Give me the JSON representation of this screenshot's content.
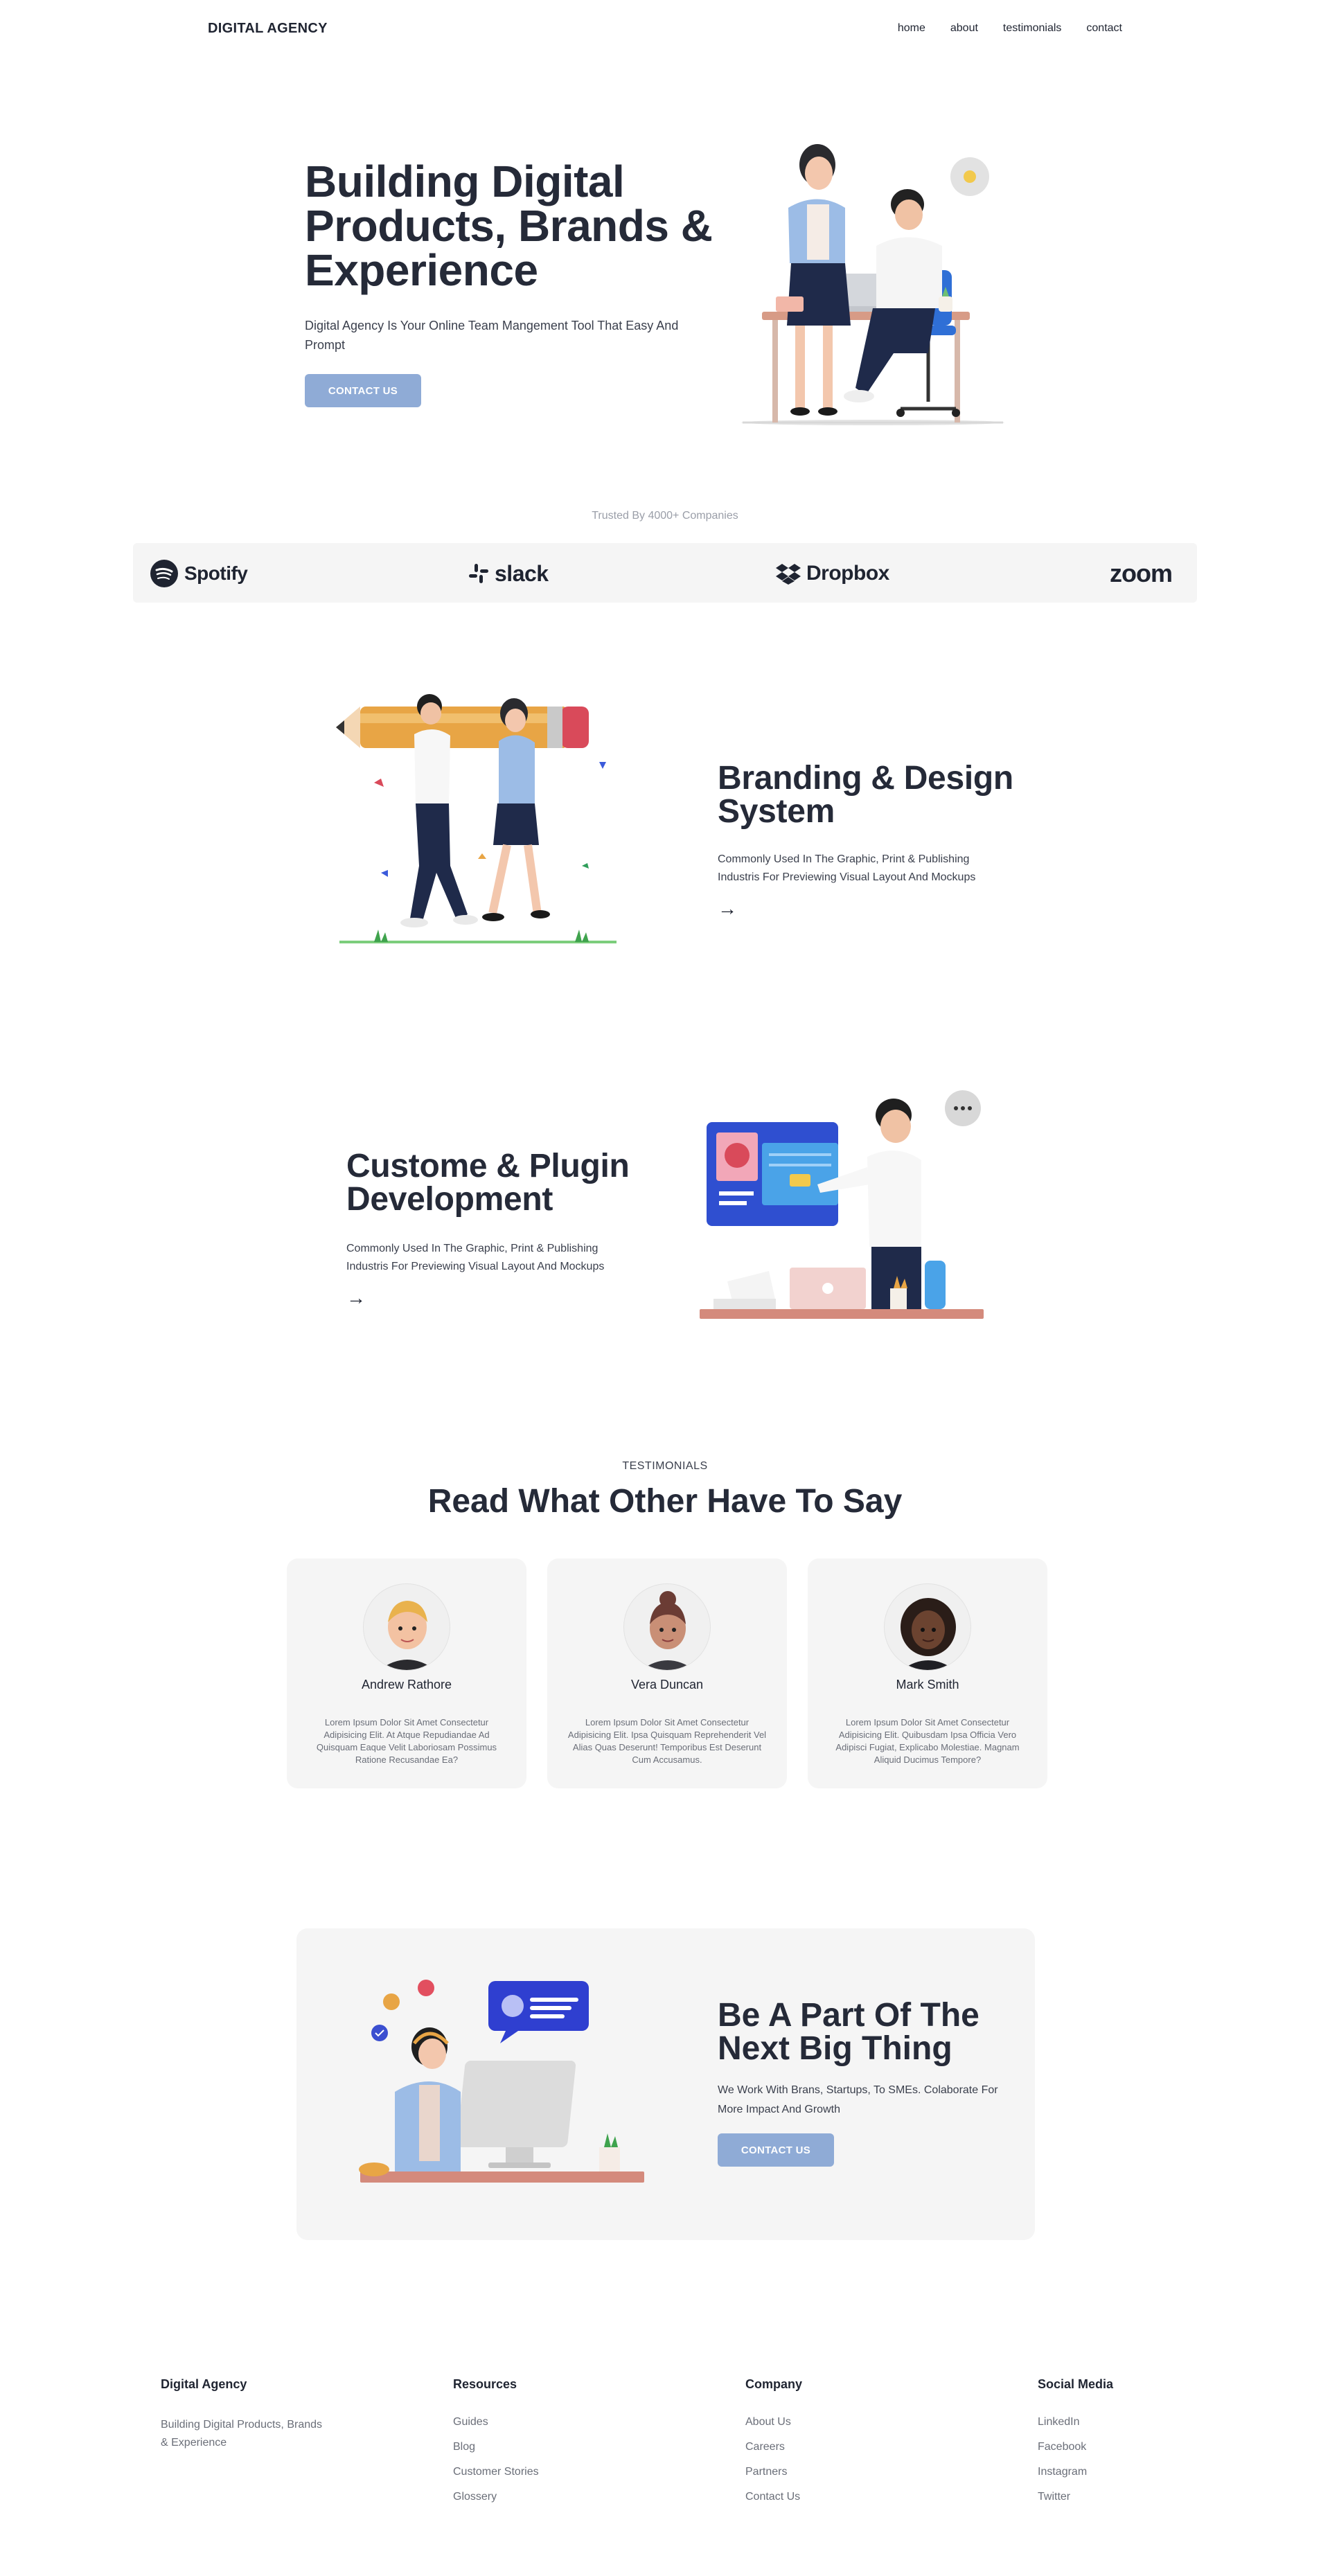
{
  "nav": {
    "brand": "DIGITAL AGENCY",
    "links": [
      "home",
      "about",
      "testimonials",
      "contact"
    ]
  },
  "hero": {
    "title": "Building Digital Products, Brands & Experience",
    "subtitle": "Digital Agency Is Your Online Team Mangement Tool That Easy And Prompt",
    "cta": "CONTACT US"
  },
  "trusted": {
    "label": "Trusted By 4000+ Companies",
    "logos": [
      "Spotify",
      "slack",
      "Dropbox",
      "zoom"
    ]
  },
  "features": [
    {
      "title": "Branding & Design System",
      "text": "Commonly Used In The Graphic, Print & Publishing Industris For Previewing Visual Layout And Mockups",
      "arrow": "→"
    },
    {
      "title": "Custome & Plugin Development",
      "text": "Commonly Used In The Graphic, Print & Publishing Industris For Previewing Visual Layout And Mockups",
      "arrow": "→"
    }
  ],
  "testimonials": {
    "eyebrow": "TESTIMONIALS",
    "title": "Read What Other Have To Say",
    "items": [
      {
        "name": "Andrew Rathore",
        "text": "Lorem Ipsum Dolor Sit Amet Consectetur Adipisicing Elit. At Atque Repudiandae Ad Quisquam Eaque Velit Laboriosam Possimus Ratione Recusandae Ea?"
      },
      {
        "name": "Vera Duncan",
        "text": "Lorem Ipsum Dolor Sit Amet Consectetur Adipisicing Elit. Ipsa Quisquam Reprehenderit Vel Alias Quas Deserunt! Temporibus Est Deserunt Cum Accusamus."
      },
      {
        "name": "Mark Smith",
        "text": "Lorem Ipsum Dolor Sit Amet Consectetur Adipisicing Elit. Quibusdam Ipsa Officia Vero Adipisci Fugiat, Explicabo Molestiae. Magnam Aliquid Ducimus Tempore?"
      }
    ]
  },
  "cta": {
    "title": "Be A Part Of The Next Big Thing",
    "subtitle": "We Work With Brans, Startups, To SMEs. Colaborate For More Impact And Growth",
    "button": "CONTACT US"
  },
  "footer": {
    "brand": "Digital Agency",
    "brand_desc": "Building Digital Products, Brands & Experience",
    "columns": [
      {
        "heading": "Resources",
        "links": [
          "Guides",
          "Blog",
          "Customer Stories",
          "Glossery"
        ]
      },
      {
        "heading": "Company",
        "links": [
          "About Us",
          "Careers",
          "Partners",
          "Contact Us"
        ]
      },
      {
        "heading": "Social Media",
        "links": [
          "LinkedIn",
          "Facebook",
          "Instagram",
          "Twitter"
        ]
      }
    ]
  },
  "colors": {
    "accent_button": "#8fabd6",
    "heading": "#252a38",
    "panel": "#f5f5f5"
  }
}
